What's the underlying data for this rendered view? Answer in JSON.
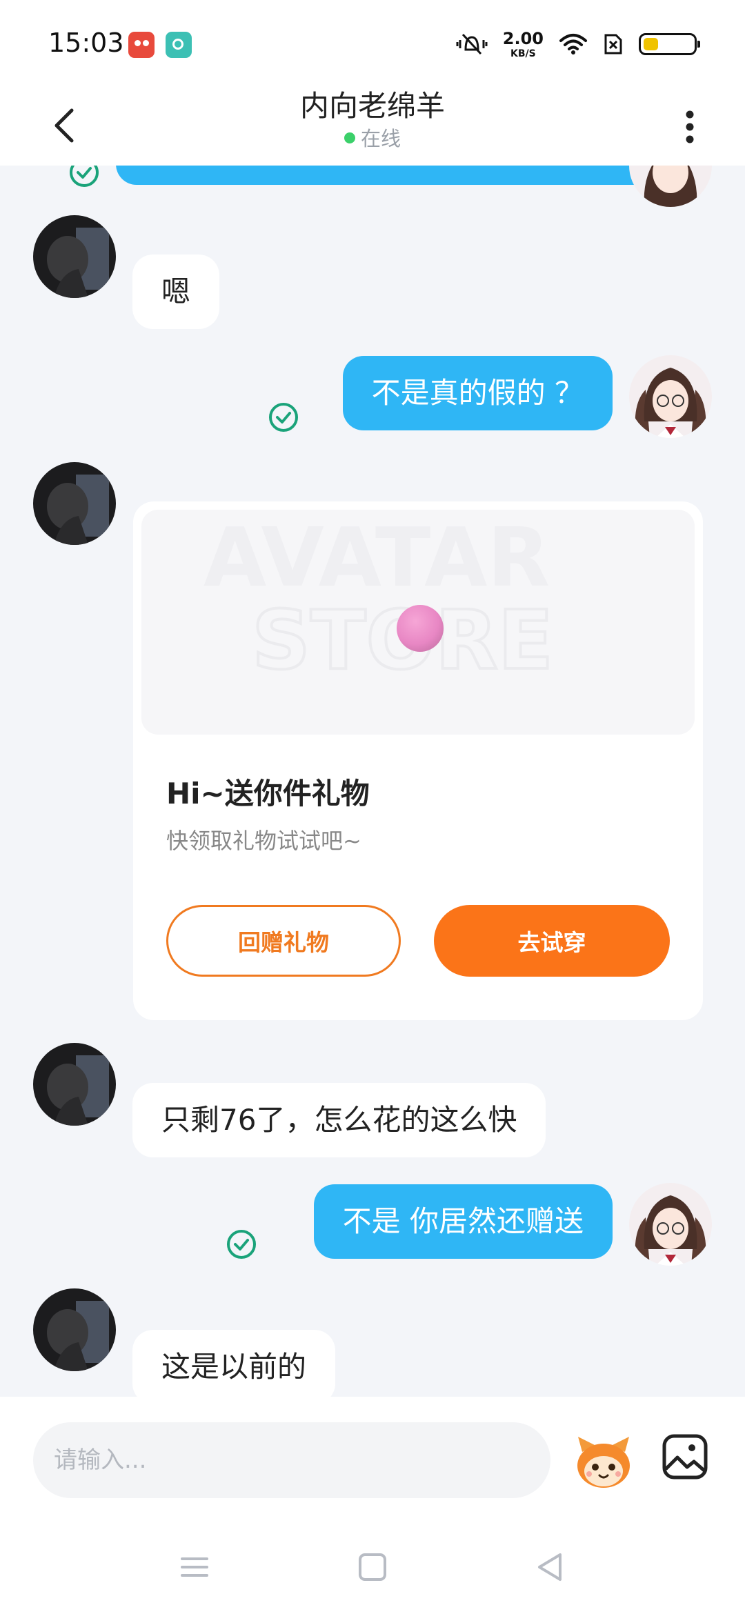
{
  "status_bar": {
    "time": "15:03",
    "net_speed_value": "2.00",
    "net_speed_unit": "KB/S",
    "battery_level": 0.3
  },
  "header": {
    "title": "内向老绵羊",
    "status": "在线"
  },
  "messages": [
    {
      "id": 1,
      "side": "in",
      "text": "嗯"
    },
    {
      "id": 2,
      "side": "out",
      "text": "不是真的假的 ？",
      "read": true
    },
    {
      "id": 3,
      "side": "in",
      "type": "gift"
    },
    {
      "id": 4,
      "side": "in",
      "text": "只剩76了，怎么花的这么快"
    },
    {
      "id": 5,
      "side": "out",
      "text": "不是 你居然还赠送",
      "read": true
    },
    {
      "id": 6,
      "side": "in",
      "text": "这是以前的"
    }
  ],
  "gift_card": {
    "banner_text_1": "AVATAR",
    "banner_text_2": "STORE",
    "title": "Hi~送你件礼物",
    "subtitle": "快领取礼物试试吧~",
    "return_gift_label": "回赠礼物",
    "try_on_label": "去试穿"
  },
  "input": {
    "placeholder": "请输入..."
  },
  "colors": {
    "outgoing_bubble": "#2fb6f5",
    "online": "#3bd06a",
    "accent_orange": "#fb7418",
    "read_check": "#1aa37a"
  },
  "icons": [
    "back-arrow-icon",
    "more-vertical-icon",
    "read-check-icon",
    "sticker-icon",
    "image-icon",
    "menu-nav-icon",
    "home-nav-icon",
    "back-nav-icon"
  ]
}
